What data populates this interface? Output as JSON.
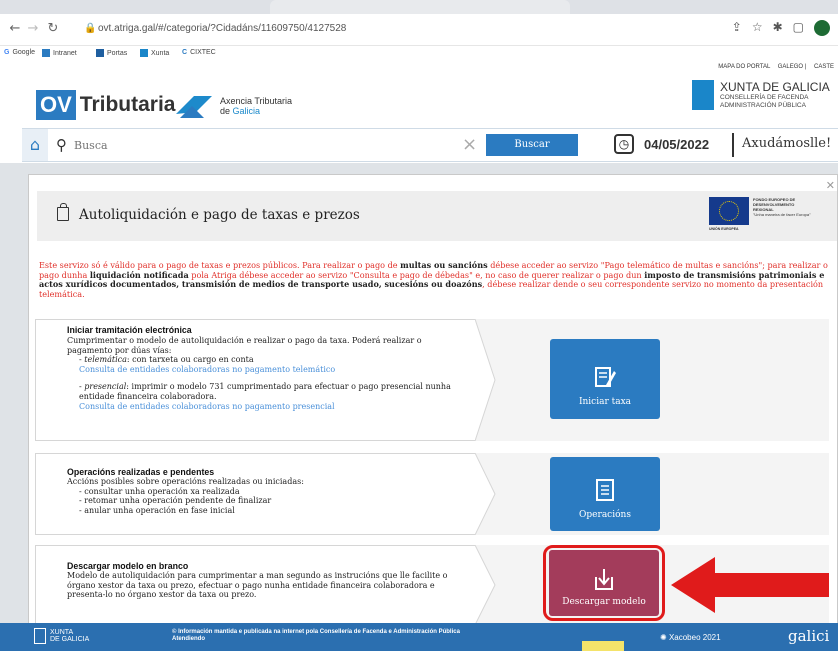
{
  "browser": {
    "url": "ovt.atriga.gal/#/categoria/?Cidadáns/11609750/4127528",
    "bookmarks": [
      "Google",
      "Intranet",
      "Portas",
      "Xunta",
      "CIXTEC"
    ]
  },
  "header": {
    "top_links": [
      "MAPA DO PORTAL",
      "GALEGO",
      "CASTE"
    ],
    "ov_box": "OV",
    "ov_text": "Tributaria",
    "atriga_line1": "Axencia Tributaria",
    "atriga_line2_prefix": "de ",
    "atriga_line2_highlight": "Galicia",
    "xunta_name": "XUNTA DE GALICIA",
    "xunta_sub1": "CONSELLERÍA DE FACENDA",
    "xunta_sub2": "ADMINISTRACIÓN PÚBLICA"
  },
  "search": {
    "placeholder": "Busca",
    "button": "Buscar",
    "date": "04/05/2022",
    "help": "Axudámoslle!"
  },
  "modal": {
    "title": "Autoliquidación e pago de taxas e prezos",
    "eu": {
      "line1": "FONDO EUROPEO DE",
      "line2": "DESENVOLVEMENTO",
      "line3": "REXIONAL",
      "motto": "\"Unha maneira de facer Europa\"",
      "caption": "UNIÓN EUROPEA"
    },
    "notice": {
      "p1": "Este servizo só é válido para o pago de taxas e prezos públicos. Para realizar o pago de ",
      "b1": "multas ou sancións",
      "p2": " débese acceder ao servizo \"Pago telemático de multas e sancións\"; para realizar o pago dunha ",
      "b2": "liquidación notificada",
      "p3": " pola Atriga débese acceder ao servizo \"Consulta e pago de débedas\" e, no caso de querer realizar o pago dun ",
      "b3": "imposto de transmisións patrimoniais e actos xurídicos documentados, transmisión de medios de transporte usado, sucesións ou doazóns",
      "p4": ", débese realizar dende o seu correspondente servizo no momento da presentación telemática."
    },
    "sections": [
      {
        "title": "Iniciar tramitación electrónica",
        "intro": "Cumprimentar o modelo de autoliquidación e realizar o pago da taxa. Poderá realizar o pagamento por dúas vías:",
        "item1_em": "telemática",
        "item1_rest": ": con tarxeta ou cargo en conta",
        "link1": "Consulta de entidades colaboradoras no pagamento telemático",
        "item2_em": "presencial",
        "item2_rest": ": imprimir o modelo 731 cumprimentado para efectuar o pago presencial nunha entidade financeira colaboradora.",
        "link2": "Consulta de entidades colaboradoras no pagamento presencial",
        "button": "Iniciar taxa"
      },
      {
        "title": "Operacións realizadas e pendentes",
        "intro": "Accións posibles sobre operacións realizadas ou iniciadas:",
        "items": [
          "- consultar unha operación xa realizada",
          "- retomar unha operación pendente de finalizar",
          "- anular unha operación en fase inicial"
        ],
        "button": "Operacións"
      },
      {
        "title": "Descargar modelo en branco",
        "text": "Modelo de autoliquidación para cumprimentar a man segundo as instrucións que lle facilite o órgano xestor da taxa ou prezo, efectuar o pago nunha entidade financeira colaboradora e presenta-lo no órgano xestor da taxa ou prezo.",
        "button": "Descargar modelo"
      }
    ]
  },
  "footer": {
    "xunta1": "XUNTA",
    "xunta2": "DE GALICIA",
    "info": "© Información mantida e publicada na internet pola Consellería de Facenda e Administración Pública",
    "info2": "Atendiendo",
    "xacobeo": "Xacobeo 2021",
    "galicia": "galici"
  },
  "colors": {
    "brand_blue": "#2b7bc1",
    "notice_red": "#e0302a",
    "highlight_red": "#e01b1b",
    "download_button": "#a33c5b"
  }
}
